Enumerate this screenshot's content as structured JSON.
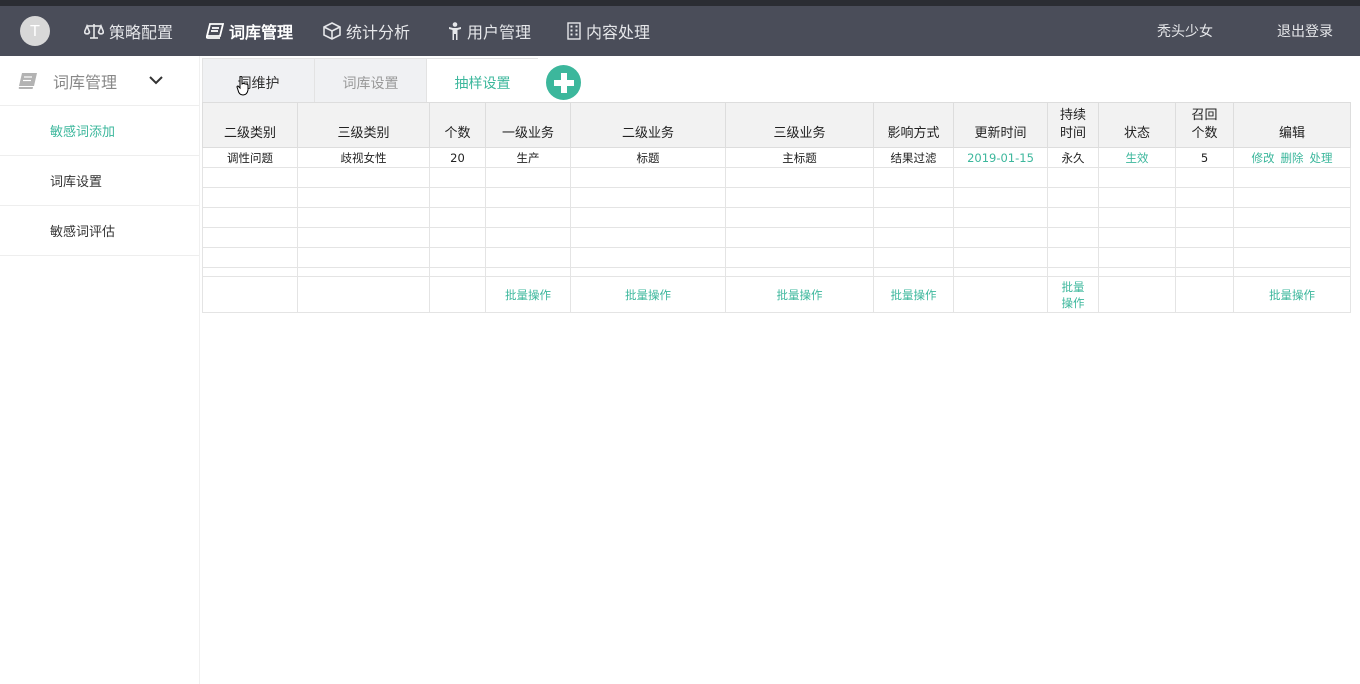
{
  "header": {
    "avatar_letter": "T",
    "nav": [
      {
        "label": "策略配置",
        "icon": "scale-icon",
        "active": false
      },
      {
        "label": "词库管理",
        "icon": "book-icon",
        "active": true
      },
      {
        "label": "统计分析",
        "icon": "cube-icon",
        "active": false
      },
      {
        "label": "用户管理",
        "icon": "person-icon",
        "active": false
      },
      {
        "label": "内容处理",
        "icon": "building-icon",
        "active": false
      }
    ],
    "username": "秃头少女",
    "logout": "退出登录"
  },
  "sidebar": {
    "title": "词库管理",
    "items": [
      {
        "label": "敏感词添加",
        "active": true
      },
      {
        "label": "词库设置",
        "active": false
      },
      {
        "label": "敏感词评估",
        "active": false
      }
    ]
  },
  "tabs": [
    {
      "label": "词维护",
      "active": false
    },
    {
      "label": "词库设置",
      "active": false
    },
    {
      "label": "抽样设置",
      "active": true
    }
  ],
  "colors": {
    "accent": "#3cb79c",
    "topbar": "#4a4d59"
  },
  "table": {
    "headers": [
      "二级类别",
      "三级类别",
      "个数",
      "一级业务",
      "二级业务",
      "三级业务",
      "影响方式",
      "更新时间",
      "持续\n时间",
      "状态",
      "召回\n个数",
      "编辑"
    ],
    "rows": [
      [
        "调性问题",
        "歧视女性",
        "20",
        "生产",
        "标题",
        "主标题",
        "结果过滤",
        "2019-01-15",
        "永久",
        "生效",
        "5"
      ]
    ],
    "edit_actions": [
      "修改",
      "删除",
      "处理"
    ],
    "batch_label": "批量操作",
    "batch_short": "批量\n操作"
  }
}
